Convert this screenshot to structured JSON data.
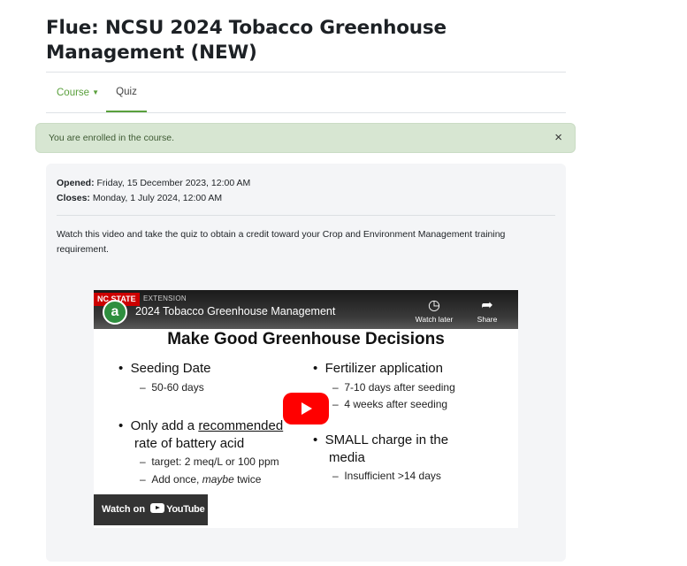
{
  "page": {
    "title": "Flue: NCSU 2024 Tobacco Greenhouse Management (NEW)"
  },
  "nav": {
    "course_label": "Course",
    "quiz_label": "Quiz"
  },
  "alert": {
    "message": "You are enrolled in the course.",
    "close_label": "×"
  },
  "quiz": {
    "opened_label": "Opened:",
    "opened_value": "Friday, 15 December 2023, 12:00 AM",
    "closes_label": "Closes:",
    "closes_value": "Monday, 1 July 2024, 12:00 AM",
    "description": "Watch this video and take the quiz to obtain a credit toward your Crop and Environment Management training requirement."
  },
  "video": {
    "brand_red": "NC STATE",
    "brand_ext": "EXTENSION",
    "channel_initial": "a",
    "title": "2024 Tobacco Greenhouse Management",
    "watch_later_label": "Watch later",
    "share_label": "Share",
    "watch_on_label": "Watch on",
    "youtube_label": "YouTube",
    "slide": {
      "heading": "Make Good Greenhouse Decisions",
      "left": {
        "b1": "Seeding Date",
        "b1_sub1": "50-60 days",
        "b2_pre": "Only add a ",
        "b2_underlined": "recommended",
        "b2_line2": "rate of battery acid",
        "b2_sub1": "target: 2 meq/L or 100 ppm",
        "b2_sub2_pre": "Add once, ",
        "b2_sub2_em": "maybe",
        "b2_sub2_post": " twice"
      },
      "right": {
        "b1": "Fertilizer application",
        "b1_sub1": "7-10 days after seeding",
        "b1_sub2": "4 weeks after seeding",
        "b2_line1": "SMALL charge in the",
        "b2_line2": "media",
        "b2_sub1": "Insufficient >14 days"
      }
    }
  },
  "icons": {
    "caret": "chevron-down-icon",
    "close": "close-icon",
    "play": "play-icon",
    "watch_later": "clock-icon",
    "share": "share-icon"
  }
}
